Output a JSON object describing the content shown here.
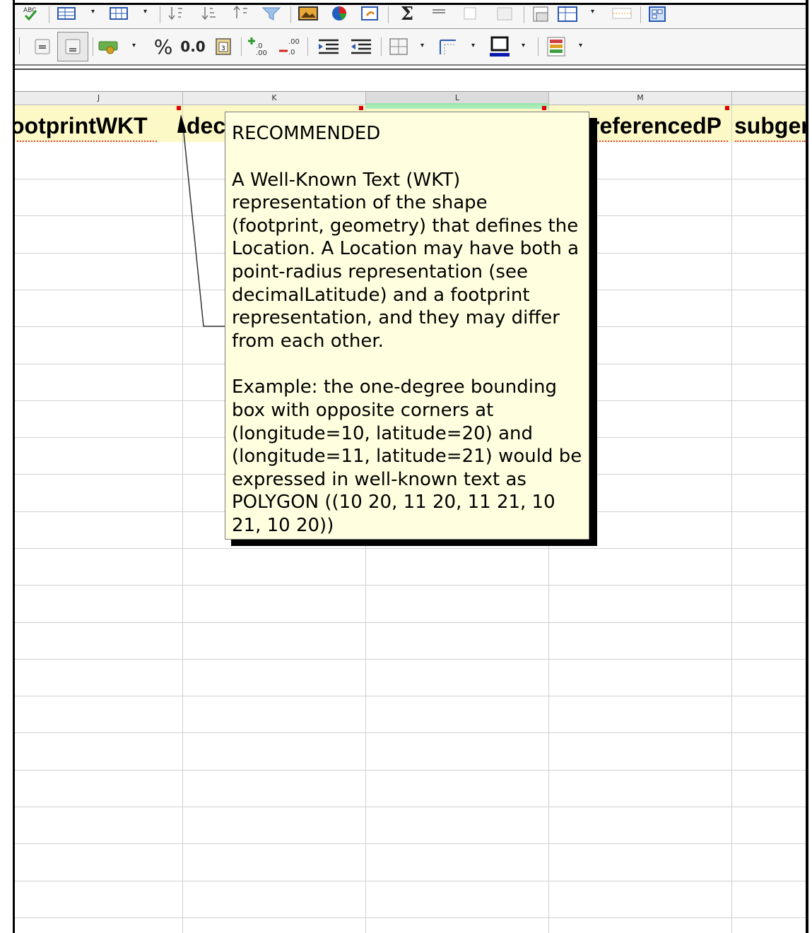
{
  "toolbar_top": {
    "sigma": "Σ"
  },
  "toolbar_format": {
    "percent": "%",
    "decimal": "0.0"
  },
  "columns": [
    "J",
    "K",
    "L",
    "M"
  ],
  "header_cells": {
    "j": "ootprintWKT",
    "k": "dec",
    "m": "referencedP",
    "n": "subger"
  },
  "comment": {
    "line1": "RECOMMENDED",
    "para1": "A Well-Known Text (WKT) representation of the shape (footprint, geometry) that defines the Location. A Location may have both a point-radius representation (see decimalLatitude) and a footprint representation, and they may differ from each other.",
    "para2": "Example: the one-degree bounding box with opposite corners at (longitude=10, latitude=20) and (longitude=11, latitude=21) would be expressed in well-known text as POLYGON ((10 20, 11 20, 11 21, 10 21, 10 20))"
  },
  "colors": {
    "header_fill": "#fdf9c6",
    "comment_fill": "#ffffe0",
    "selected_col": "#9fe3b1",
    "marker": "#e00000"
  }
}
